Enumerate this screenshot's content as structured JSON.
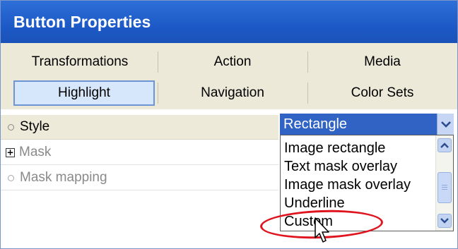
{
  "window": {
    "title": "Button Properties"
  },
  "tabs": {
    "row1": [
      "Transformations",
      "Action",
      "Media"
    ],
    "row2": [
      "Highlight",
      "Navigation",
      "Color Sets"
    ],
    "active": "Highlight"
  },
  "properties": [
    {
      "label": "Style",
      "kind": "bullet",
      "enabled": true
    },
    {
      "label": "Mask",
      "kind": "expander",
      "enabled": false
    },
    {
      "label": "Mask mapping",
      "kind": "bullet",
      "enabled": false
    }
  ],
  "style_dropdown": {
    "selected": "Rectangle",
    "options": [
      "Image rectangle",
      "Text mask overlay",
      "Image mask overlay",
      "Underline",
      "Custom"
    ],
    "highlighted_option": "Custom"
  },
  "icons": {
    "dropdown_arrow": "chevron-down-icon",
    "scroll_up": "chevron-up-icon",
    "scroll_down": "chevron-down-icon",
    "expander": "plus-box-icon",
    "cursor": "mouse-pointer-icon"
  },
  "colors": {
    "title_bar": "#1d5ac7",
    "selection": "#3163c5",
    "annotation": "#e0141e",
    "tab_active": "#d6e6fb"
  }
}
